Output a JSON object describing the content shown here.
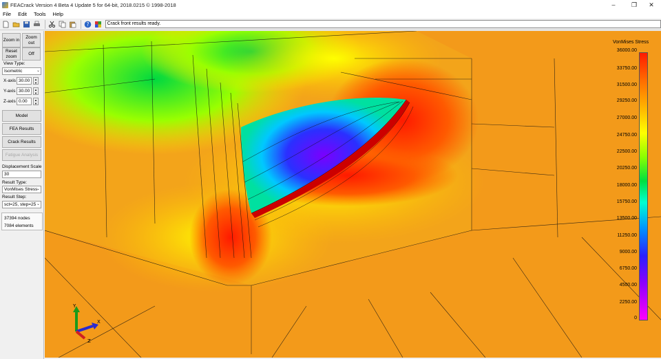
{
  "window": {
    "title": "FEACrack Version 4 Beta 4 Update 5 for 64-bit, 2018.0215 © 1998-2018",
    "minimize": "–",
    "maximize": "❐",
    "close": "✕"
  },
  "menu": [
    "File",
    "Edit",
    "Tools",
    "Help"
  ],
  "toolbar": {
    "icons": [
      "new-file-icon",
      "open-folder-icon",
      "save-icon",
      "print-icon",
      "cut-icon",
      "copy-icon",
      "paste-icon",
      "help-icon",
      "color-palette-icon"
    ],
    "status_message": "Crack front results ready."
  },
  "left_panel": {
    "zoom_in": "Zoom in",
    "zoom_out": "Zoom out",
    "reset_zoom": "Reset zoom",
    "off": "Off",
    "view_type_label": "View Type:",
    "view_type_value": "Isometric",
    "x_axis_label": "X-axis",
    "x_axis_value": "30.00",
    "y_axis_label": "Y-axis",
    "y_axis_value": "30.00",
    "z_axis_label": "Z-axis",
    "z_axis_value": "0.00",
    "model_button": "Model",
    "fea_results_button": "FEA Results",
    "crack_results_button": "Crack Results",
    "fatigue_analysis_button": "Fatigue Analysis",
    "displacement_scale_label": "Displacement Scale",
    "displacement_scale_value": "30",
    "result_type_label": "Result Type:",
    "result_type_value": "VonMises Stress",
    "result_step_label": "Result Step:",
    "result_step_value": "sct=25, step=25",
    "nodes": "37394 nodes",
    "elements": "7084 elements"
  },
  "legend": {
    "title": "VonMises Stress",
    "ticks": [
      "36000.00",
      "33750.00",
      "31500.00",
      "29250.00",
      "27000.00",
      "24750.00",
      "22500.00",
      "20250.00",
      "18000.00",
      "15750.00",
      "13500.00",
      "11250.00",
      "9000.00",
      "6750.00",
      "4500.00",
      "2250.00",
      "0"
    ],
    "max_color": "#ff1a00",
    "min_color": "#ff00ff"
  },
  "axes_triad": {
    "x": "X",
    "y": "Y",
    "z": "Z"
  },
  "colors": {
    "background": "#f39a1a",
    "accent": "#0078d7"
  }
}
